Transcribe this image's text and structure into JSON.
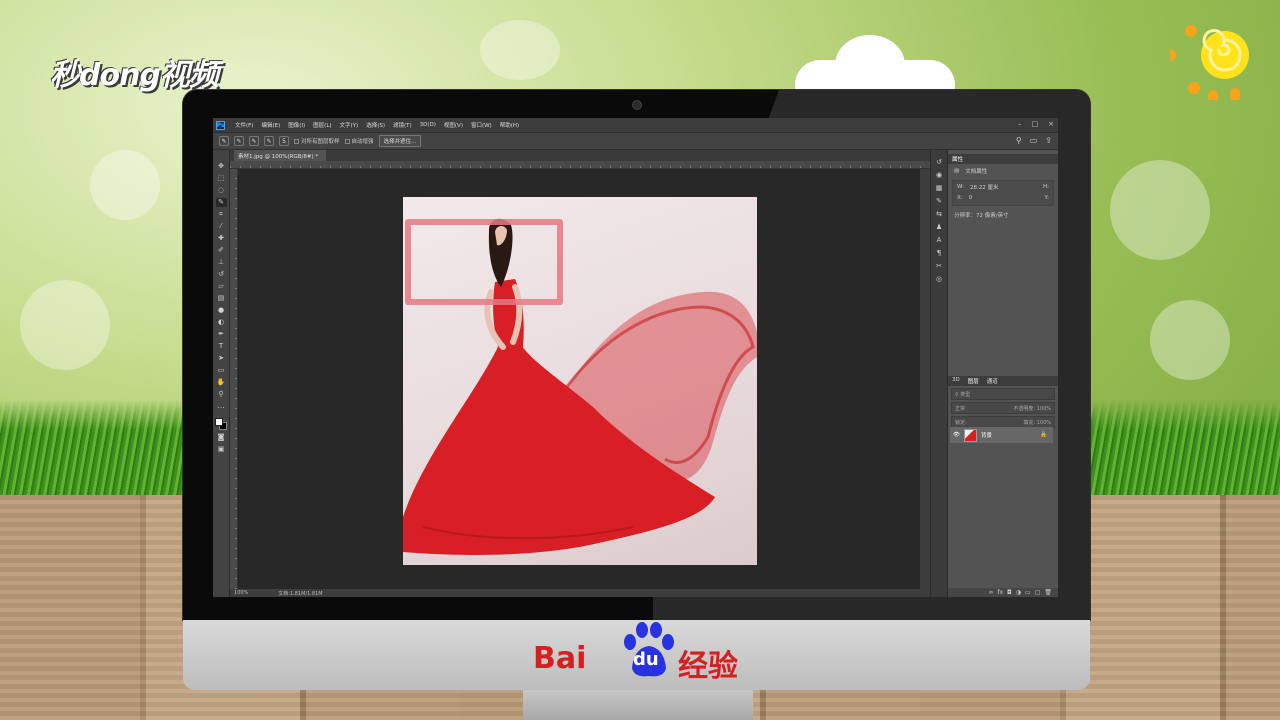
{
  "watermark": {
    "left_logo": "秒dong视频"
  },
  "brand": {
    "bai": "Bai",
    "du": "du",
    "jingyan": "经验"
  },
  "photoshop": {
    "app_icon": "Ps",
    "menu": [
      "文件(F)",
      "编辑(E)",
      "图像(I)",
      "图层(L)",
      "文字(Y)",
      "选择(S)",
      "滤镜(T)",
      "3D(D)",
      "视图(V)",
      "窗口(W)",
      "帮助(H)"
    ],
    "window_controls": [
      "–",
      "□",
      "×"
    ],
    "options": {
      "brush_size": "5",
      "sample_all_layers": "对所有图层取样",
      "auto_enhance": "自动增强",
      "select_and_mask": "选择并遮住..."
    },
    "document_tab": "素材1.jpg @ 100%(RGB/8#) *",
    "status": {
      "zoom": "100%",
      "doc_size": "文档:1.81M/1.81M"
    },
    "properties_panel": {
      "title": "属性",
      "section": "文档属性",
      "width_label": "W:",
      "width_value": "28.22 厘米",
      "height_label": "H:",
      "x_label": "X:",
      "x_value": "0",
      "y_label": "Y:",
      "resolution": "分辨率：72 像素/英寸"
    },
    "layers_panel": {
      "tabs": [
        "3D",
        "图层",
        "通道"
      ],
      "search_placeholder": "类型",
      "blend_mode": "正常",
      "opacity_label": "不透明度:",
      "opacity_value": "100%",
      "lock_label": "锁定:",
      "fill_label": "填充:",
      "fill_value": "100%",
      "layer_name": "背景"
    }
  },
  "colors": {
    "highlight": "#e97882",
    "dress": "#d71f25",
    "ps_dark": "#282828"
  }
}
